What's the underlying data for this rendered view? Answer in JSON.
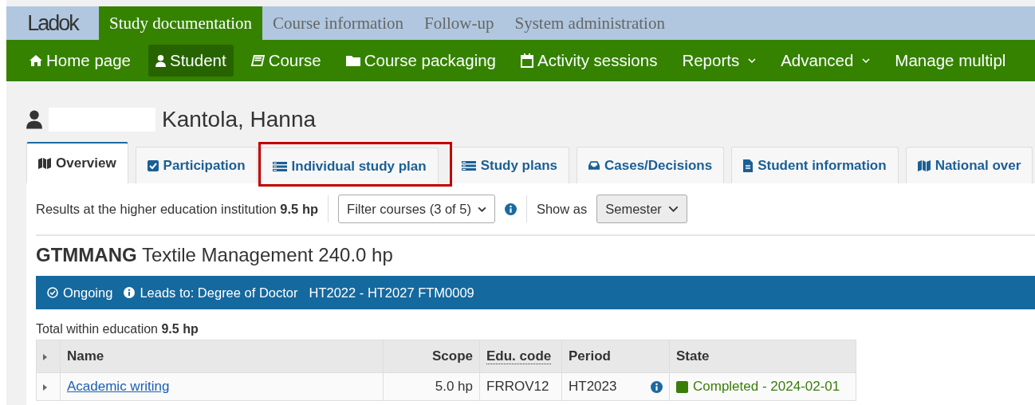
{
  "logo": {
    "text": "Ladok"
  },
  "top_tabs": [
    {
      "label": "Study documentation",
      "selected": true
    },
    {
      "label": "Course information",
      "selected": false
    },
    {
      "label": "Follow-up",
      "selected": false
    },
    {
      "label": "System administration",
      "selected": false
    }
  ],
  "nav": [
    {
      "label": "Home page",
      "kind": "home",
      "selected": false,
      "dropdown": false
    },
    {
      "label": "Student",
      "kind": "user",
      "selected": true,
      "dropdown": false
    },
    {
      "label": "Course",
      "kind": "book",
      "selected": false,
      "dropdown": false
    },
    {
      "label": "Course packaging",
      "kind": "folder",
      "selected": false,
      "dropdown": false
    },
    {
      "label": "Activity sessions",
      "kind": "calendar",
      "selected": false,
      "dropdown": false
    },
    {
      "label": "Reports",
      "kind": "plain",
      "selected": false,
      "dropdown": true
    },
    {
      "label": "Advanced",
      "kind": "plain",
      "selected": false,
      "dropdown": true
    },
    {
      "label": "Manage multipl",
      "kind": "plain",
      "selected": false,
      "dropdown": false
    }
  ],
  "student": {
    "name": "Kantola, Hanna"
  },
  "tabs": [
    {
      "label": "Overview",
      "kind": "map",
      "selected": true,
      "highlighted": false
    },
    {
      "label": "Participation",
      "kind": "check",
      "selected": false,
      "highlighted": false
    },
    {
      "label": "Individual study plan",
      "kind": "list",
      "selected": false,
      "highlighted": true
    },
    {
      "label": "Study plans",
      "kind": "list",
      "selected": false,
      "highlighted": false
    },
    {
      "label": "Cases/Decisions",
      "kind": "inbox",
      "selected": false,
      "highlighted": false
    },
    {
      "label": "Student information",
      "kind": "file",
      "selected": false,
      "highlighted": false
    },
    {
      "label": "National over",
      "kind": "map",
      "selected": false,
      "highlighted": false
    }
  ],
  "toolbar": {
    "results": "Results at the higher education institution **9.5 hp**",
    "filter": "Filter courses (3 of 5)",
    "show_as_label": "Show as",
    "show_as_value": "Semester"
  },
  "programme": {
    "code": "GTMMANG",
    "title": "Textile Management 240.0 hp",
    "status": "Ongoing",
    "leads_to": "Leads to: Degree of Doctor",
    "period": "HT2022 - HT2027 FTM0009",
    "total": "Total within education **9.5 hp**"
  },
  "table": {
    "columns": [
      {
        "label": "Name",
        "abbr": false
      },
      {
        "label": "Scope",
        "abbr": false
      },
      {
        "label": "Edu. code",
        "abbr": true
      },
      {
        "label": "Period",
        "abbr": false
      },
      {
        "label": "State",
        "abbr": false
      }
    ],
    "rows": [
      {
        "name": "Academic writing",
        "scope": "5.0 hp",
        "edu_code": "FRROV12",
        "period": "HT2023",
        "state": "Completed - 2024-02-01",
        "color": "#3a7d0a"
      }
    ]
  }
}
